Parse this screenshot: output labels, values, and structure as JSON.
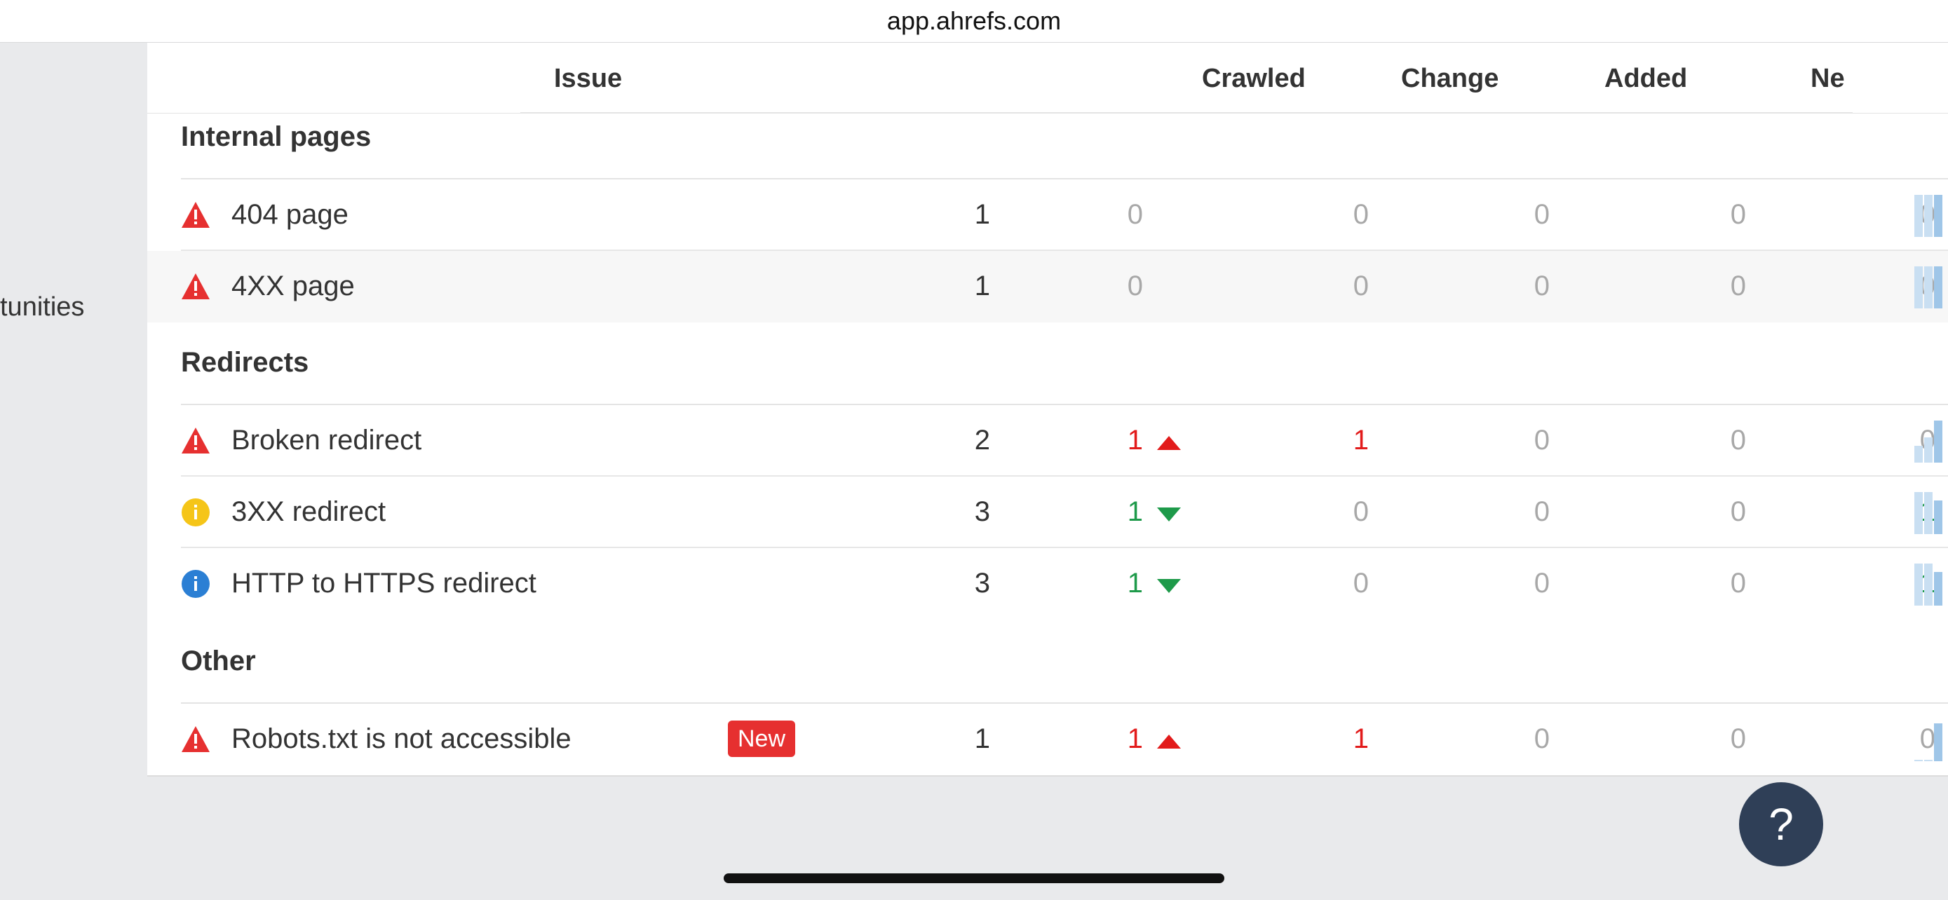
{
  "browser": {
    "url": "app.ahrefs.com"
  },
  "sidebar": {
    "partial_label": "tunities"
  },
  "table": {
    "headers": {
      "issue": "Issue",
      "crawled": "Crawled",
      "change": "Change",
      "added": "Added",
      "new": "Ne"
    },
    "groups": [
      {
        "title": "Internal pages",
        "rows": [
          {
            "icon": "error-triangle-icon",
            "name": "404 page",
            "count": "1",
            "delta": "0",
            "crawled": "0",
            "change": "0",
            "added": "0",
            "new": "0"
          },
          {
            "icon": "error-triangle-icon",
            "name": "4XX page",
            "count": "1",
            "delta": "0",
            "crawled": "0",
            "change": "0",
            "added": "0",
            "new": "0"
          }
        ]
      },
      {
        "title": "Redirects",
        "rows": [
          {
            "icon": "error-triangle-icon",
            "name": "Broken redirect",
            "count": "2",
            "delta": "1",
            "delta_dir": "up",
            "crawled": "1",
            "change": "0",
            "added": "0",
            "new": "0"
          },
          {
            "icon": "warning-info-icon",
            "name": "3XX redirect",
            "count": "3",
            "delta": "1",
            "delta_dir": "down",
            "crawled": "0",
            "change": "0",
            "added": "0",
            "new": "1"
          },
          {
            "icon": "notice-info-icon",
            "name": "HTTP to HTTPS redirect",
            "count": "3",
            "delta": "1",
            "delta_dir": "down",
            "crawled": "0",
            "change": "0",
            "added": "0",
            "new": "1"
          }
        ]
      },
      {
        "title": "Other",
        "rows": [
          {
            "icon": "error-triangle-icon",
            "name": "Robots.txt is not accessible",
            "badge": "New",
            "count": "1",
            "delta": "1",
            "delta_dir": "up",
            "crawled": "1",
            "change": "0",
            "added": "0",
            "new": "0"
          }
        ]
      }
    ]
  },
  "help": {
    "label": "?"
  },
  "colors": {
    "error": "#e63030",
    "warning": "#f5c518",
    "notice": "#2b7fd4",
    "increase": "#e21b1b",
    "decrease": "#1e9a4a",
    "help_button": "#2f3f57"
  }
}
